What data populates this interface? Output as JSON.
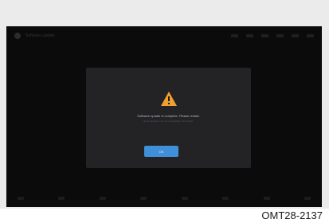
{
  "screen": {
    "app_title": "Software update",
    "dialog": {
      "icon": "warning-icon",
      "message": "Software update is complete. Please restart.",
      "sub_message": "Some features may be unavailable until restart.",
      "ok_label": "OK"
    }
  },
  "caption": "OMT28-2137",
  "colors": {
    "screen_bg": "#0b0b0c",
    "dialog_bg": "#232326",
    "warning": "#f0a030",
    "button": "#3f8fd9"
  }
}
